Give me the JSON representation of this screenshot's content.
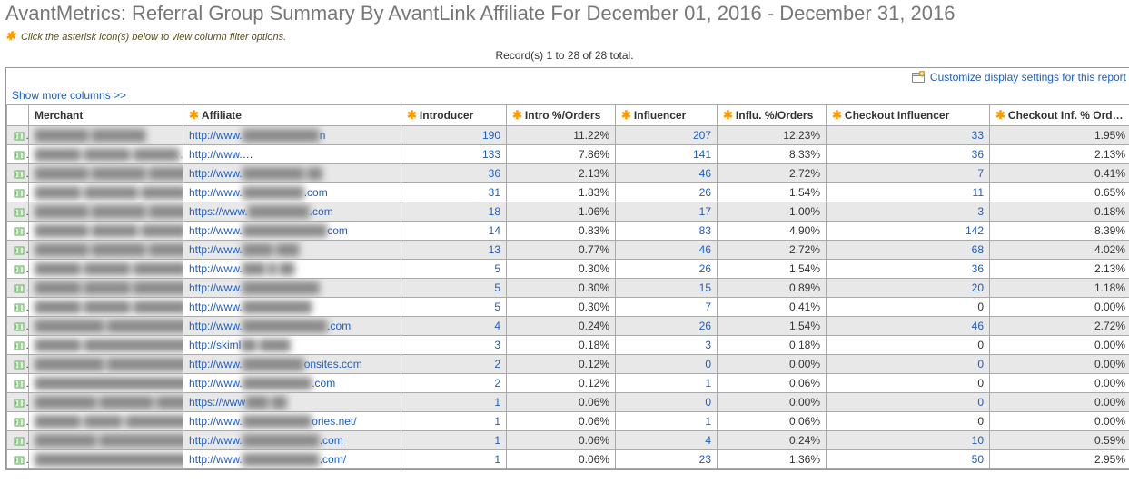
{
  "title": "AvantMetrics: Referral Group Summary By AvantLink Affiliate For December 01, 2016 - December 31, 2016",
  "subtitle_text": "Click the asterisk icon(s) below to view column filter options.",
  "records_text": "Record(s) 1 to 28 of 28 total.",
  "customize_link": "Customize display settings for this report",
  "show_more_link": "Show more columns >>",
  "columns": {
    "merchant": "Merchant",
    "affiliate": "Affiliate",
    "introducer": "Introducer",
    "intro_pct": "Intro %/Orders",
    "influencer": "Influencer",
    "influ_pct": "Influ. %/Orders",
    "checkout_inf": "Checkout Influencer",
    "checkout_pct": "Checkout Inf. % Orders"
  },
  "rows": [
    {
      "merchant": "███████ ███████",
      "affiliate": "http://www.██████████n",
      "introducer": "190",
      "intro_pct": "11.22%",
      "influencer": "207",
      "influ_pct": "12.23%",
      "checkout_inf": "33",
      "checkout_pct": "1.95%"
    },
    {
      "merchant": "██████ ██████ ██████",
      "affiliate": "http://www.██████ ████/██████████",
      "introducer": "133",
      "intro_pct": "7.86%",
      "influencer": "141",
      "influ_pct": "8.33%",
      "checkout_inf": "36",
      "checkout_pct": "2.13%"
    },
    {
      "merchant": "███████ ███████ ███████",
      "affiliate": "http://www.████████ ██",
      "introducer": "36",
      "intro_pct": "2.13%",
      "influencer": "46",
      "influ_pct": "2.72%",
      "checkout_inf": "7",
      "checkout_pct": "0.41%"
    },
    {
      "merchant": "██████ ███████ ██████",
      "affiliate": "http://www.████████.com",
      "introducer": "31",
      "intro_pct": "1.83%",
      "influencer": "26",
      "influ_pct": "1.54%",
      "checkout_inf": "11",
      "checkout_pct": "0.65%"
    },
    {
      "merchant": "███████ ███████ ███████",
      "affiliate": "https://www.████████.com",
      "introducer": "18",
      "intro_pct": "1.06%",
      "influencer": "17",
      "influ_pct": "1.00%",
      "checkout_inf": "3",
      "checkout_pct": "0.18%"
    },
    {
      "merchant": "███████ ██████ ██████",
      "affiliate": "http://www.███████████com",
      "introducer": "14",
      "intro_pct": "0.83%",
      "influencer": "83",
      "influ_pct": "4.90%",
      "checkout_inf": "142",
      "checkout_pct": "8.39%"
    },
    {
      "merchant": "███████ ███████ ██████",
      "affiliate": "http://www.████ ███",
      "introducer": "13",
      "intro_pct": "0.77%",
      "influencer": "46",
      "influ_pct": "2.72%",
      "checkout_inf": "68",
      "checkout_pct": "4.02%"
    },
    {
      "merchant": "██████ ██████ ███████",
      "affiliate": "http://www.███ █ ██",
      "introducer": "5",
      "intro_pct": "0.30%",
      "influencer": "26",
      "influ_pct": "1.54%",
      "checkout_inf": "36",
      "checkout_pct": "2.13%"
    },
    {
      "merchant": "██████ ██████ ████████",
      "affiliate": "http://www.██████████",
      "introducer": "5",
      "intro_pct": "0.30%",
      "influencer": "15",
      "influ_pct": "0.89%",
      "checkout_inf": "20",
      "checkout_pct": "1.18%"
    },
    {
      "merchant": "██████ ██████ ███████",
      "affiliate": "http://www.█████████",
      "introducer": "5",
      "intro_pct": "0.30%",
      "influencer": "7",
      "influ_pct": "0.41%",
      "checkout_inf_plain": "0",
      "checkout_pct": "0.00%"
    },
    {
      "merchant": "█████████ ████████████",
      "affiliate": "http://www.███████████.com",
      "introducer": "4",
      "intro_pct": "0.24%",
      "influencer": "26",
      "influ_pct": "1.54%",
      "checkout_inf": "46",
      "checkout_pct": "2.72%"
    },
    {
      "merchant": "██████ ██████████████████",
      "affiliate": "http://skiml██ ████",
      "introducer": "3",
      "intro_pct": "0.18%",
      "influencer": "3",
      "influ_pct": "0.18%",
      "checkout_inf_plain": "0",
      "checkout_pct": "0.00%"
    },
    {
      "merchant": "█████████ ██████████████",
      "affiliate": "http://www.████████onsites.com",
      "introducer": "2",
      "intro_pct": "0.12%",
      "influencer": "0",
      "influ_pct": "0.00%",
      "checkout_inf": "0",
      "checkout_pct": "0.00%"
    },
    {
      "merchant": "██████████████████████",
      "affiliate": "http://www.█████████.com",
      "introducer": "2",
      "intro_pct": "0.12%",
      "influencer": "1",
      "influ_pct": "0.06%",
      "checkout_inf_plain": "0",
      "checkout_pct": "0.00%"
    },
    {
      "merchant": "████████ ███████ ███████",
      "affiliate": "https://www███ ██",
      "introducer": "1",
      "intro_pct": "0.06%",
      "influencer": "0",
      "influ_pct": "0.00%",
      "checkout_inf": "0",
      "checkout_pct": "0.00%"
    },
    {
      "merchant": "██████ █████ ███████████",
      "affiliate": "http://www.█████████ories.net/",
      "introducer": "1",
      "intro_pct": "0.06%",
      "influencer": "1",
      "influ_pct": "0.06%",
      "checkout_inf_plain": "0",
      "checkout_pct": "0.00%"
    },
    {
      "merchant": "████████ ██████████████",
      "affiliate": "http://www.██████████.com",
      "introducer": "1",
      "intro_pct": "0.06%",
      "influencer": "4",
      "influ_pct": "0.24%",
      "checkout_inf": "10",
      "checkout_pct": "0.59%"
    },
    {
      "merchant": "████████████████████████",
      "affiliate": "http://www.██████████.com/",
      "introducer": "1",
      "intro_pct": "0.06%",
      "influencer": "23",
      "influ_pct": "1.36%",
      "checkout_inf": "50",
      "checkout_pct": "2.95%"
    }
  ]
}
